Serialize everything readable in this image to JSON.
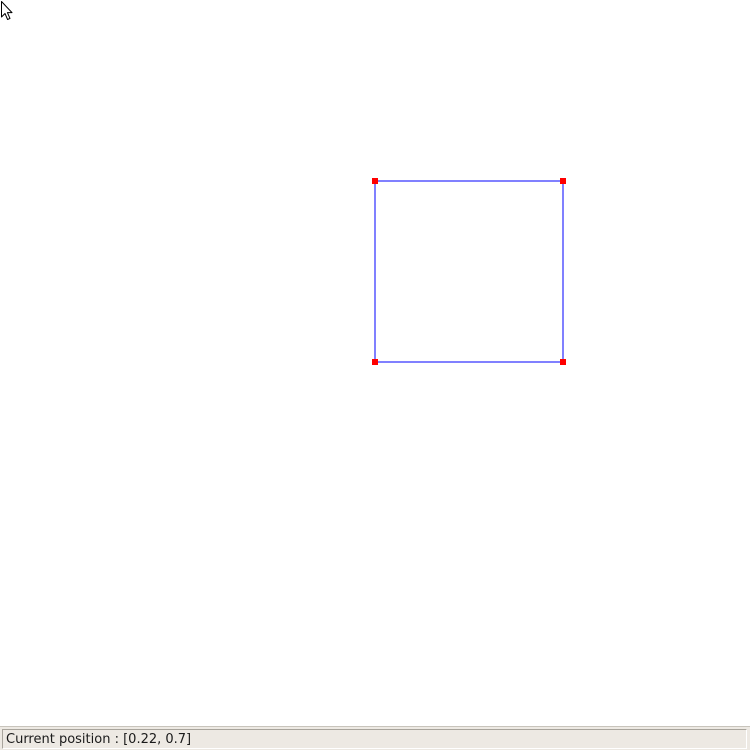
{
  "statusbar": {
    "position_text": "Current position : [0.22, 0.7]"
  },
  "canvas": {
    "shape_stroke_color": "#0000ff",
    "handle_color": "#ff0000",
    "background_color": "#ffffff"
  },
  "cursor": {
    "icon": "arrow-pointer-icon"
  }
}
